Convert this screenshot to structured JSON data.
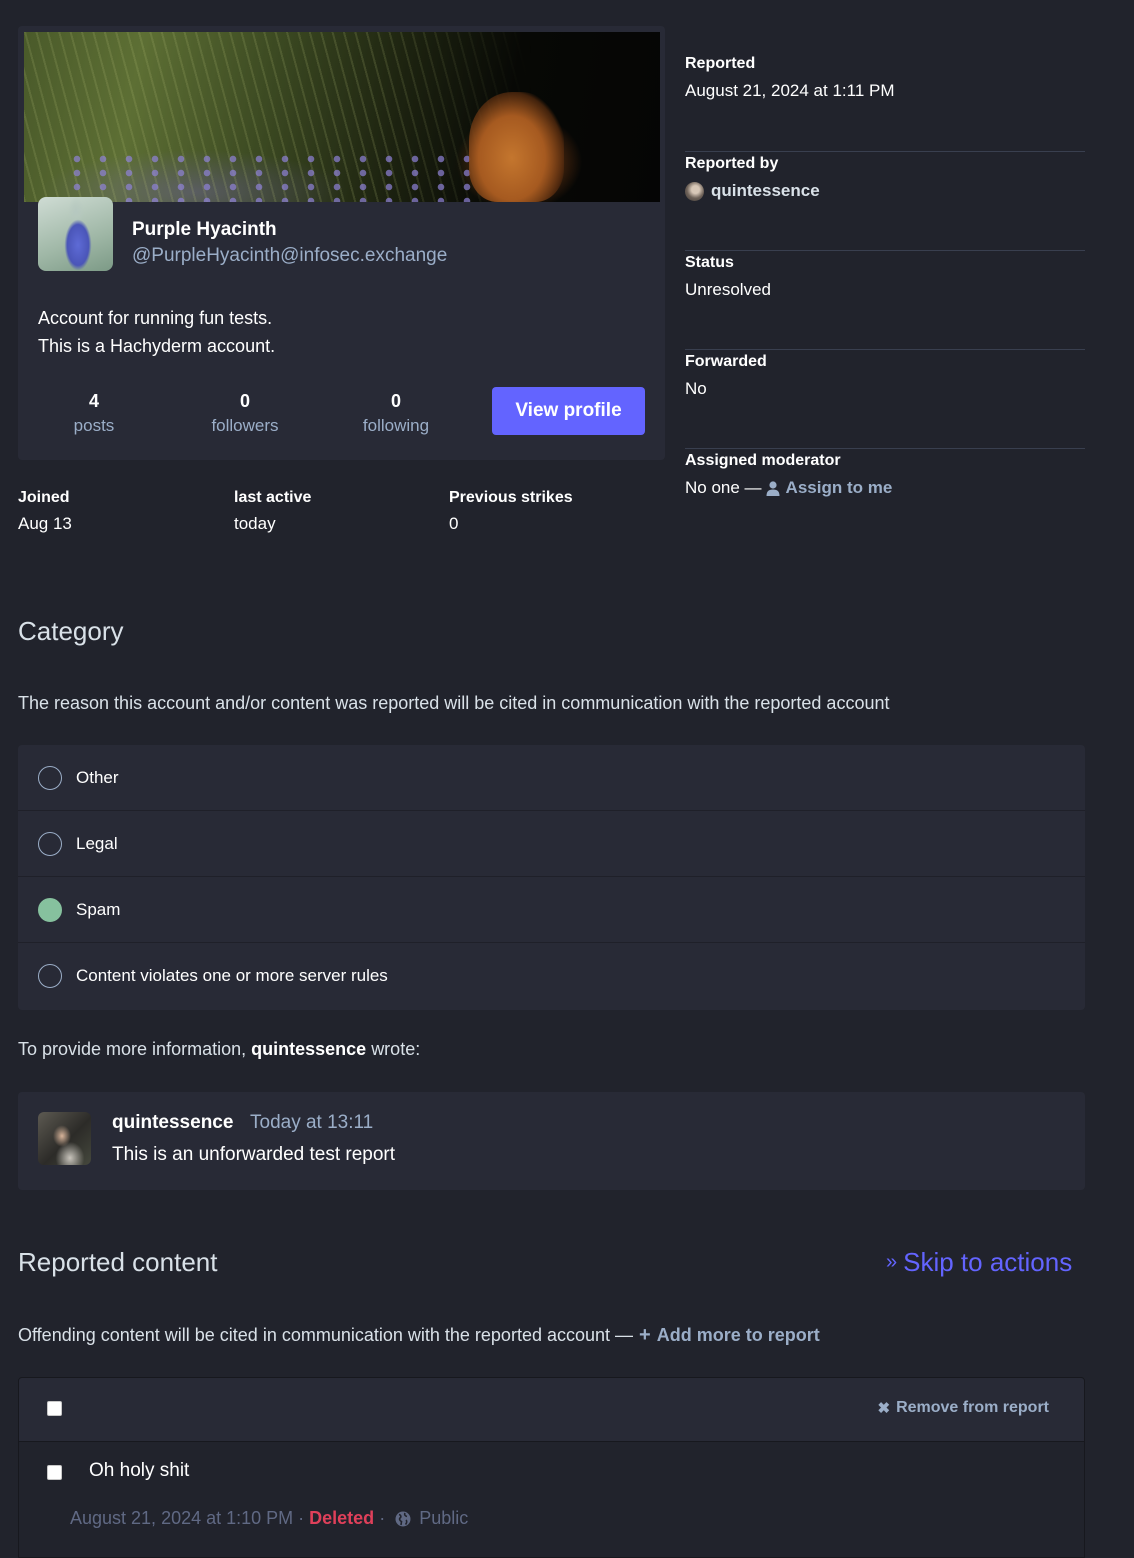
{
  "account": {
    "display_name": "Purple Hyacinth",
    "handle": "@PurpleHyacinth@infosec.exchange",
    "bio_lines": [
      "Account for running fun tests.",
      "This is a Hachyderm account."
    ],
    "stats": [
      {
        "value": "4",
        "label": "posts"
      },
      {
        "value": "0",
        "label": "followers"
      },
      {
        "value": "0",
        "label": "following"
      }
    ],
    "view_profile_label": "View profile",
    "meta": [
      {
        "label": "Joined",
        "value": "Aug 13"
      },
      {
        "label": "last active",
        "value": "today"
      },
      {
        "label": "Previous strikes",
        "value": "0"
      }
    ]
  },
  "report_info": {
    "reported": {
      "label": "Reported",
      "value": "August 21, 2024 at 1:11 PM"
    },
    "reported_by": {
      "label": "Reported by",
      "value": "quintessence"
    },
    "status": {
      "label": "Status",
      "value": "Unresolved"
    },
    "forwarded": {
      "label": "Forwarded",
      "value": "No"
    },
    "assigned_moderator": {
      "label": "Assigned moderator",
      "value": "No one —",
      "assign_label": "Assign to me"
    }
  },
  "category": {
    "title": "Category",
    "description": "The reason this account and/or content was reported will be cited in communication with the reported account",
    "options": [
      {
        "label": "Other",
        "checked": false
      },
      {
        "label": "Legal",
        "checked": false
      },
      {
        "label": "Spam",
        "checked": true
      },
      {
        "label": "Content violates one or more server rules",
        "checked": false
      }
    ]
  },
  "comment": {
    "intro_prefix": "To provide more information,",
    "intro_author": "quintessence",
    "intro_suffix": "wrote:",
    "author": "quintessence",
    "time": "Today at 13:11",
    "text": "This is an unforwarded test report"
  },
  "reported_content": {
    "title": "Reported content",
    "skip_label": "Skip to actions",
    "description": "Offending content will be cited in communication with the reported account —",
    "add_more_label": "Add more to report",
    "remove_label": "Remove from report",
    "statuses": [
      {
        "text": "Oh holy shit",
        "date": "August 21, 2024 at 1:10 PM",
        "deleted_label": "Deleted",
        "visibility": "Public"
      }
    ]
  },
  "colors": {
    "accent": "#6364ff",
    "selected_radio": "#86c19e",
    "deleted": "#df405a",
    "muted": "#9baec8"
  }
}
